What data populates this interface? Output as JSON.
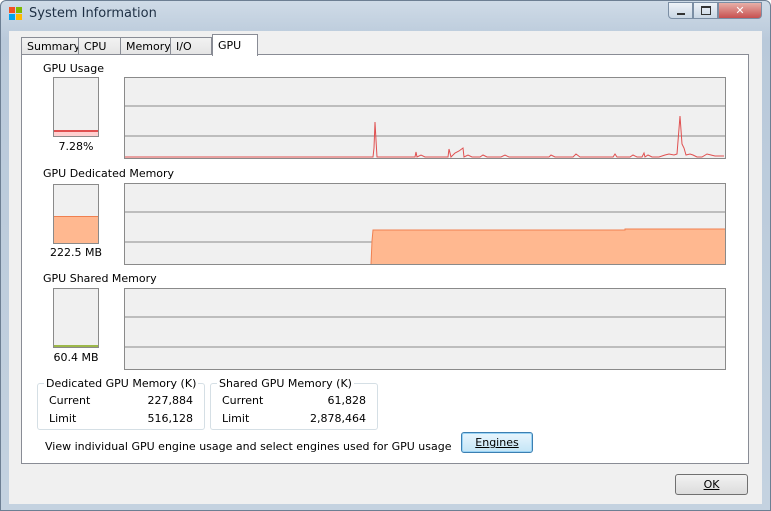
{
  "window": {
    "title": "System Information",
    "ok_label": "OK"
  },
  "tabs": [
    "Summary",
    "CPU",
    "Memory",
    "I/O",
    "GPU"
  ],
  "active_tab": "GPU",
  "gpu_usage": {
    "label": "GPU Usage",
    "value": "7.28%",
    "percent": 7.28,
    "color": "#e05050"
  },
  "gpu_dedicated": {
    "label": "GPU Dedicated Memory",
    "value": "222.5 MB",
    "fill_fraction": 0.44,
    "color": "#ffb890"
  },
  "gpu_shared": {
    "label": "GPU Shared Memory",
    "value": "60.4 MB",
    "fill_fraction": 0.02,
    "color": "#9db84a"
  },
  "dedicated_box": {
    "title": "Dedicated GPU Memory (K)",
    "rows": [
      {
        "label": "Current",
        "value": "227,884"
      },
      {
        "label": "Limit",
        "value": "516,128"
      }
    ]
  },
  "shared_box": {
    "title": "Shared GPU Memory (K)",
    "rows": [
      {
        "label": "Current",
        "value": "61,828"
      },
      {
        "label": "Limit",
        "value": "2,878,464"
      }
    ]
  },
  "engines_hint": "View individual GPU engine usage and select engines used for GPU usage",
  "engines_button": "Engines",
  "icons": {
    "app": "system-information-icon",
    "minimize": "minimize-icon",
    "maximize": "maximize-icon",
    "close": "close-icon"
  },
  "colors": {
    "usage_line": "#e05050",
    "dedicated_area": "#ffb890",
    "dedicated_line": "#f08050",
    "graph_bg": "#f0f0f0",
    "grid": "#8a8a8a"
  }
}
